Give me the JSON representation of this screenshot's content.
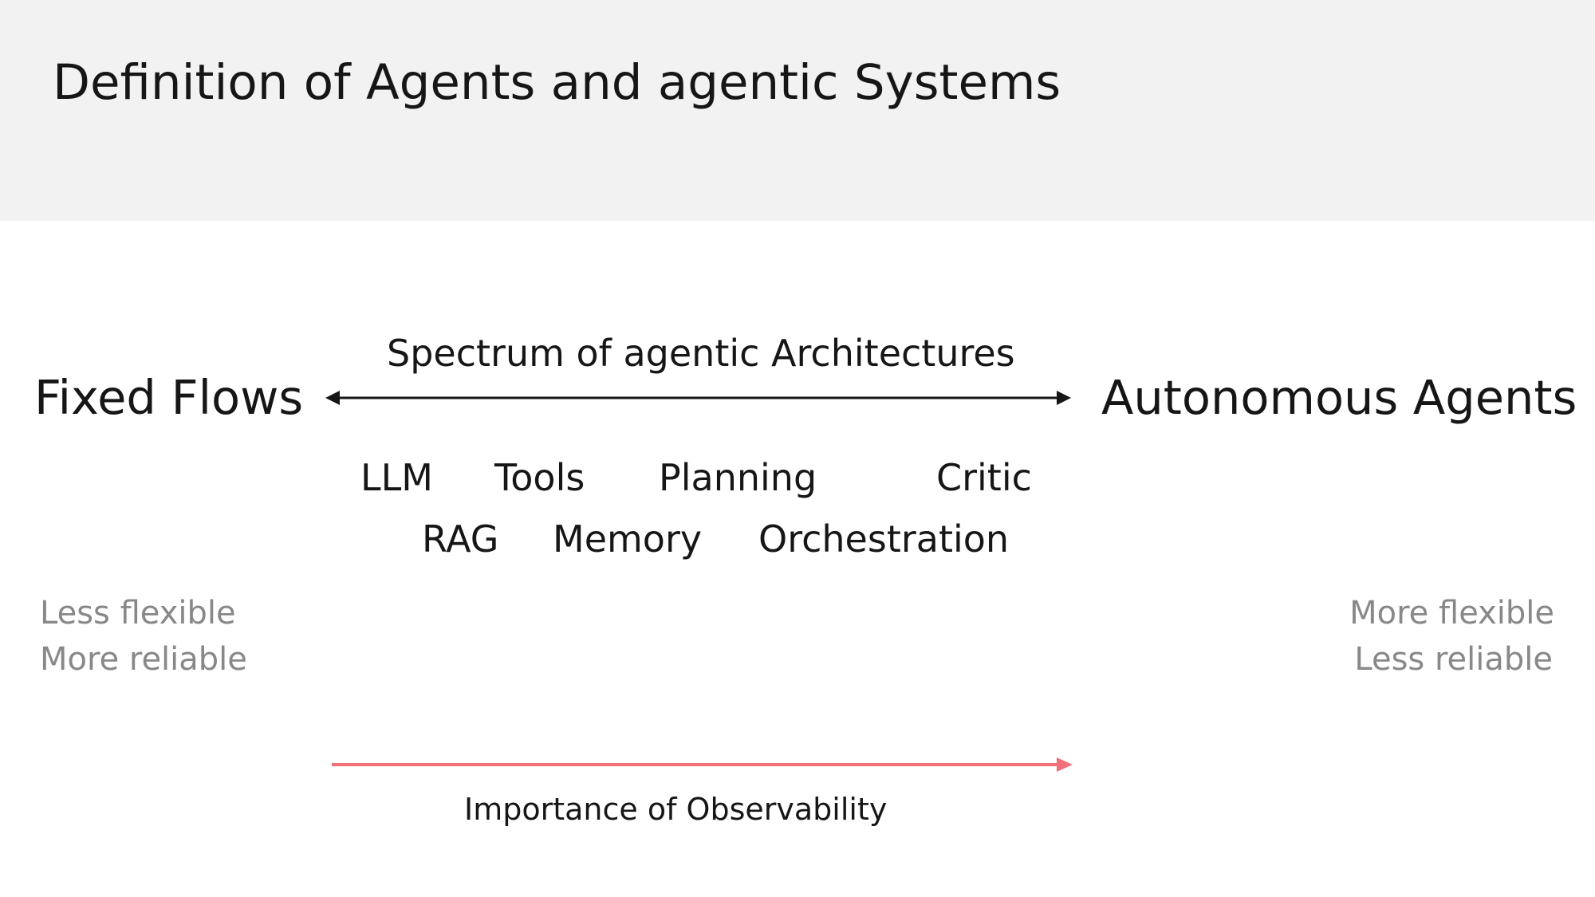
{
  "title": "Definition of Agents and agentic Systems",
  "spectrum": {
    "label": "Spectrum of agentic Architectures",
    "left_end": "Fixed Flows",
    "right_end": "Autonomous Agents"
  },
  "components": {
    "row1": [
      "LLM",
      "Tools",
      "Planning",
      "Critic"
    ],
    "row2": [
      "RAG",
      "Memory",
      "Orchestration"
    ]
  },
  "tradeoffs": {
    "left": [
      "Less flexible",
      "More reliable"
    ],
    "right": [
      "More flexible",
      "Less reliable"
    ]
  },
  "observability": {
    "label": "Importance of Observability",
    "color": "#f07178"
  },
  "colors": {
    "header_band": "#f2f2f2",
    "text": "#161616",
    "muted_text": "#888888"
  }
}
